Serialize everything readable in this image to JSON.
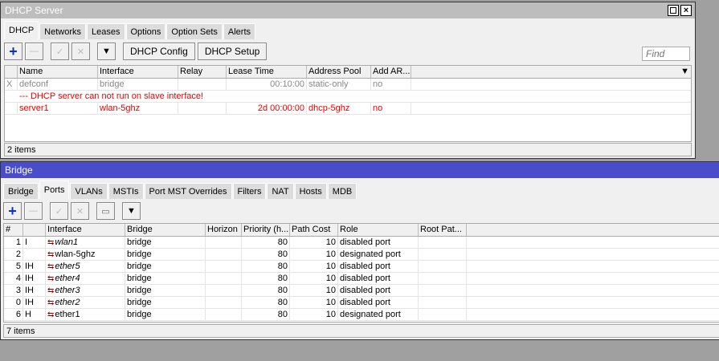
{
  "dhcp": {
    "title": "DHCP Server",
    "tabs": [
      "DHCP",
      "Networks",
      "Leases",
      "Options",
      "Option Sets",
      "Alerts"
    ],
    "toolbar": {
      "config": "DHCP Config",
      "setup": "DHCP Setup",
      "find_placeholder": "Find"
    },
    "columns": [
      "Name",
      "Interface",
      "Relay",
      "Lease Time",
      "Address Pool",
      "Add AR..."
    ],
    "rows": [
      {
        "flag": "X",
        "name": "defconf",
        "interface": "bridge",
        "relay": "",
        "lease": "00:10:00",
        "pool": "static-only",
        "arp": "no"
      },
      {
        "flag": "",
        "name": "server1",
        "interface": "wlan-5ghz",
        "relay": "",
        "lease": "2d 00:00:00",
        "pool": "dhcp-5ghz",
        "arp": "no"
      }
    ],
    "comment": "--- DHCP server can not run on slave interface!",
    "status": "2 items"
  },
  "bridge": {
    "title": "Bridge",
    "tabs": [
      "Bridge",
      "Ports",
      "VLANs",
      "MSTIs",
      "Port MST Overrides",
      "Filters",
      "NAT",
      "Hosts",
      "MDB"
    ],
    "columns": [
      "#",
      "",
      "Interface",
      "Bridge",
      "Horizon",
      "Priority (h...",
      "Path Cost",
      "Role",
      "Root Pat..."
    ],
    "rows": [
      {
        "n": "1",
        "flags": "I",
        "iface": "wlan1",
        "bridge": "bridge",
        "horizon": "",
        "prio": "80",
        "cost": "10",
        "role": "disabled port",
        "root": ""
      },
      {
        "n": "2",
        "flags": "",
        "iface": "wlan-5ghz",
        "bridge": "bridge",
        "horizon": "",
        "prio": "80",
        "cost": "10",
        "role": "designated port",
        "root": ""
      },
      {
        "n": "5",
        "flags": "IH",
        "iface": "ether5",
        "bridge": "bridge",
        "horizon": "",
        "prio": "80",
        "cost": "10",
        "role": "disabled port",
        "root": ""
      },
      {
        "n": "4",
        "flags": "IH",
        "iface": "ether4",
        "bridge": "bridge",
        "horizon": "",
        "prio": "80",
        "cost": "10",
        "role": "disabled port",
        "root": ""
      },
      {
        "n": "3",
        "flags": "IH",
        "iface": "ether3",
        "bridge": "bridge",
        "horizon": "",
        "prio": "80",
        "cost": "10",
        "role": "disabled port",
        "root": ""
      },
      {
        "n": "0",
        "flags": "IH",
        "iface": "ether2",
        "bridge": "bridge",
        "horizon": "",
        "prio": "80",
        "cost": "10",
        "role": "disabled port",
        "root": ""
      },
      {
        "n": "6",
        "flags": "H",
        "iface": "ether1",
        "bridge": "bridge",
        "horizon": "",
        "prio": "80",
        "cost": "10",
        "role": "designated port",
        "root": ""
      }
    ],
    "status": "7 items"
  }
}
